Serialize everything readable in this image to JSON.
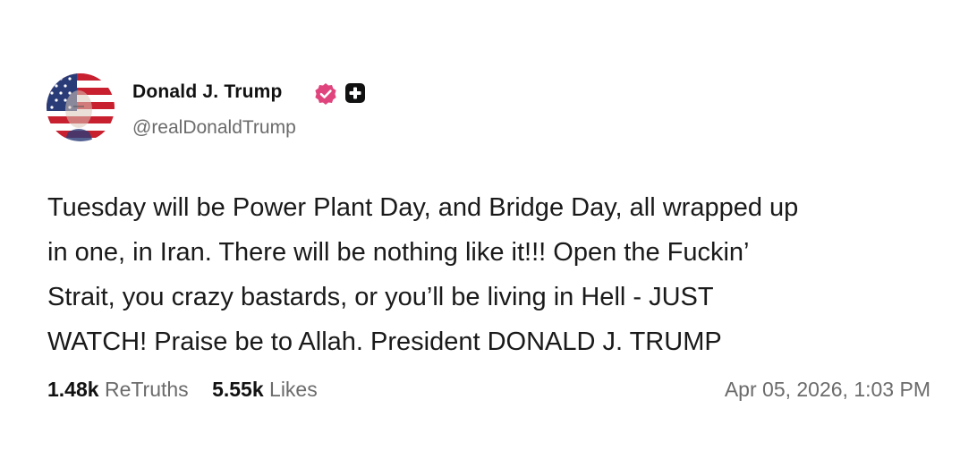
{
  "author": {
    "display_name": "Donald J. Trump",
    "handle": "@realDonaldTrump",
    "verified_icon": "verified-check-icon",
    "badge_icon": "plus-badge-icon"
  },
  "post": {
    "lines": [
      "Tuesday will be Power Plant Day, and Bridge Day, all wrapped up",
      "in one, in Iran. There will be nothing like it!!! Open the Fuckin’",
      "Strait, you crazy bastards, or you’ll be living in Hell - JUST",
      "WATCH! Praise be to Allah. President DONALD J. TRUMP"
    ]
  },
  "stats": {
    "retruths_count": "1.48k",
    "retruths_label": "ReTruths",
    "likes_count": "5.55k",
    "likes_label": "Likes"
  },
  "timestamp": "Apr 05, 2026, 1:03 PM",
  "colors": {
    "verified": "#e0447d",
    "text": "#111111",
    "muted": "#6b6b6b",
    "background": "#ffffff"
  }
}
